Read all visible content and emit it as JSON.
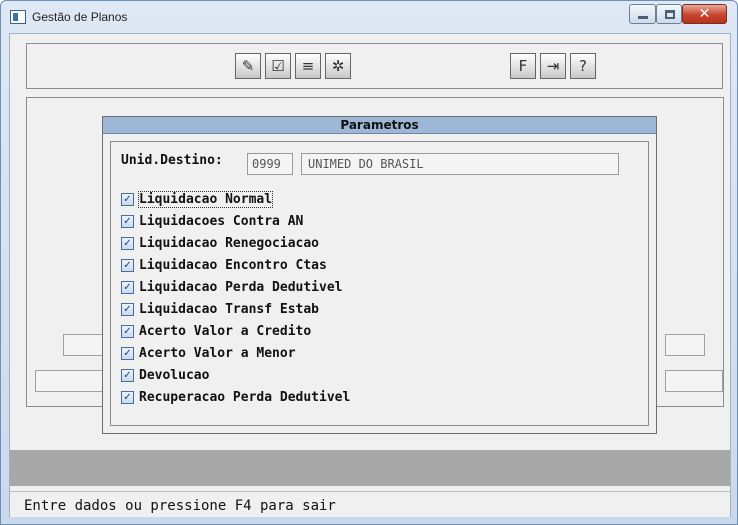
{
  "window": {
    "title": "Gestão de Planos",
    "close_glyph": "✕"
  },
  "toolbar": {
    "tools": [
      {
        "icon": "pencil-icon",
        "glyph": "✎"
      },
      {
        "icon": "checklist-icon",
        "glyph": "☑"
      },
      {
        "icon": "list-arrow-icon",
        "glyph": "≡"
      },
      {
        "icon": "gears-icon",
        "glyph": "✲"
      },
      {
        "icon": "f-key-icon",
        "glyph": "F"
      },
      {
        "icon": "exit-door-icon",
        "glyph": "⇥"
      },
      {
        "icon": "help-icon",
        "glyph": "?"
      }
    ]
  },
  "dialog": {
    "title": "Parametros",
    "dest_label": "Unid.Destino:",
    "dest_code": "0999",
    "dest_name": "UNIMED DO BRASIL",
    "options": [
      {
        "label": "Liquidacao Normal",
        "checked": true,
        "mark": "✓"
      },
      {
        "label": "Liquidacoes Contra AN",
        "checked": true,
        "mark": "✓"
      },
      {
        "label": "Liquidacao Renegociacao",
        "checked": true,
        "mark": "✓"
      },
      {
        "label": "Liquidacao Encontro Ctas",
        "checked": true,
        "mark": "✓"
      },
      {
        "label": "Liquidacao Perda Dedutivel",
        "checked": true,
        "mark": "✓"
      },
      {
        "label": "Liquidacao Transf Estab",
        "checked": true,
        "mark": "✓"
      },
      {
        "label": "Acerto Valor a Credito",
        "checked": true,
        "mark": "✓"
      },
      {
        "label": "Acerto Valor a Menor",
        "checked": true,
        "mark": "✓"
      },
      {
        "label": "Devolucao",
        "checked": true,
        "mark": "✓"
      },
      {
        "label": "Recuperacao Perda Dedutivel",
        "checked": true,
        "mark": "✓"
      }
    ]
  },
  "status": {
    "text": "Entre dados ou pressione F4 para sair"
  },
  "colors": {
    "dialog_title_bg": "#9db7d6",
    "close_button": "#c7442e",
    "gray_band": "#a8a8a8"
  }
}
